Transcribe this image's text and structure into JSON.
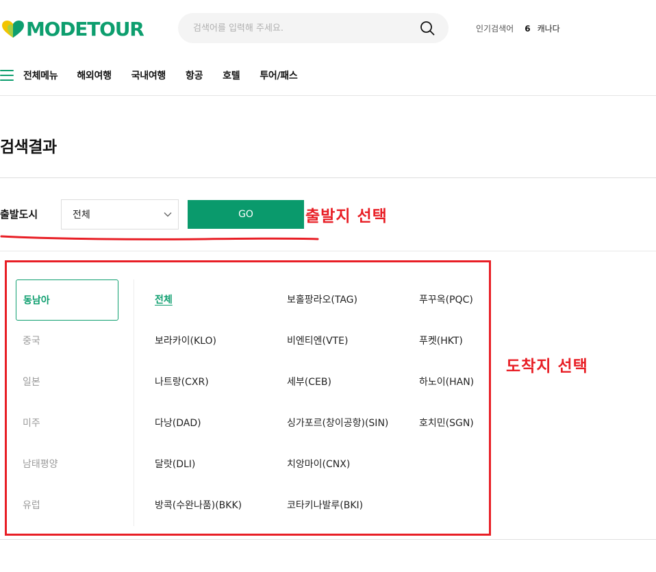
{
  "header": {
    "logo_text": "MODETOUR",
    "search_placeholder": "검색어를 입력해 주세요.",
    "popular_label": "인기검색어",
    "popular_rank": "6",
    "popular_term": "캐나다"
  },
  "nav": {
    "menu_label": "전체메뉴",
    "items": [
      "해외여행",
      "국내여행",
      "항공",
      "호텔",
      "투어/패스"
    ]
  },
  "page": {
    "title": "검색결과"
  },
  "departure": {
    "label": "출발도시",
    "selected": "전체",
    "go_label": "GO"
  },
  "regions": [
    {
      "label": "동남아",
      "active": true
    },
    {
      "label": "중국",
      "active": false
    },
    {
      "label": "일본",
      "active": false
    },
    {
      "label": "미주",
      "active": false
    },
    {
      "label": "남태평양",
      "active": false
    },
    {
      "label": "유럽",
      "active": false
    }
  ],
  "cities": {
    "col1": [
      "전체",
      "보라카이(KLO)",
      "나트랑(CXR)",
      "다낭(DAD)",
      "달랏(DLI)",
      "방콕(수완나품)(BKK)"
    ],
    "col2": [
      "보홀팡라오(TAG)",
      "비엔티엔(VTE)",
      "세부(CEB)",
      "싱가포르(창이공항)(SIN)",
      "치앙마이(CNX)",
      "코타키나발루(BKI)"
    ],
    "col3": [
      "푸꾸옥(PQC)",
      "푸켓(HKT)",
      "하노이(HAN)",
      "호치민(SGN)"
    ],
    "selected": "전체"
  },
  "annotations": {
    "departure": "출발지 선택",
    "destination": "도착지 선택",
    "color": "#e81e25"
  },
  "colors": {
    "brand": "#0d9e6e",
    "button": "#0a9a6c"
  }
}
